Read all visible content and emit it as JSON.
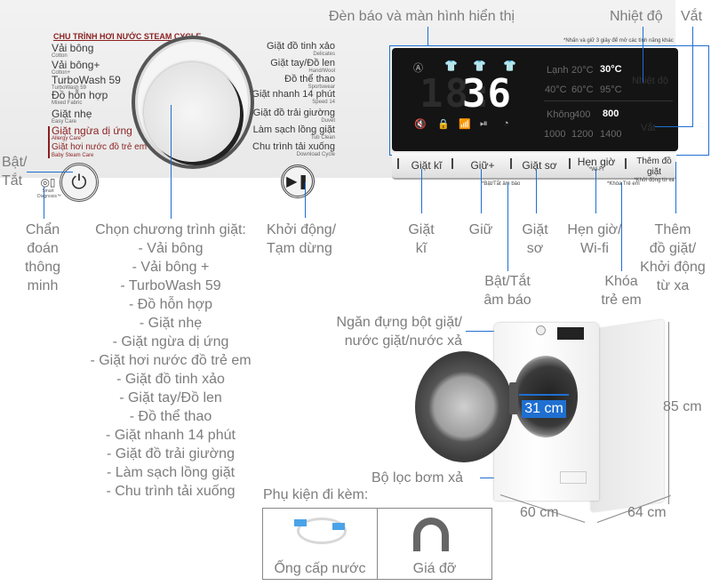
{
  "callouts": {
    "display": "Đèn báo và màn hình hiển thị",
    "temperature": "Nhiệt độ",
    "spin": "Vắt",
    "power_line1": "Bật/",
    "power_line2": "Tắt",
    "smart_diag": [
      "Chẩn",
      "đoán",
      "thông",
      "minh"
    ],
    "program_title": "Chọn chương trình giặt:",
    "program_list": [
      "- Vải bông",
      "- Vải bông +",
      "- TurboWash 59",
      "- Đồ hỗn hợp",
      "- Giặt nhẹ",
      "- Giặt ngừa dị ứng",
      "- Giặt hơi nước đồ trẻ em",
      "- Giặt đồ tinh xảo",
      "- Giặt tay/Đồ len",
      "- Đồ thể thao",
      "- Giặt nhanh 14 phút",
      "- Giặt đồ trải giường",
      "- Làm sạch lồng giặt",
      "- Chu trình tải xuống"
    ],
    "start_pause": [
      "Khởi động/",
      "Tạm dừng"
    ],
    "rinse": [
      "Giặt",
      "kĩ"
    ],
    "hold": "Giữ",
    "prewash": [
      "Giặt",
      "sơ"
    ],
    "timer_wifi": [
      "Hẹn giờ/",
      "Wi-fi"
    ],
    "add_item": [
      "Thêm",
      "đồ giặt/",
      "Khởi động",
      "từ xa"
    ],
    "sound": [
      "Bật/Tắt",
      "âm báo"
    ],
    "child_lock": [
      "Khóa",
      "trẻ em"
    ],
    "detergent": [
      "Ngăn đựng bột giặt/",
      "nước giặt/nước xả"
    ],
    "filter": "Bộ lọc bơm xả"
  },
  "panel": {
    "steam_title": "CHU TRÌNH HƠI NƯỚC STEAM CYCLE",
    "programs_left": [
      {
        "vi": "Vải bông",
        "en": "Cotton",
        "red": false
      },
      {
        "vi": "Vải bông+",
        "en": "Cotton+",
        "red": false
      },
      {
        "vi": "TurboWash 59",
        "en": "TurboWash 59",
        "red": false
      },
      {
        "vi": "Đồ hỗn hợp",
        "en": "Mixed Fabric",
        "red": false
      },
      {
        "vi": "Giặt nhẹ",
        "en": "Easy Care",
        "red": false
      },
      {
        "vi": "Giặt ngừa dị ứng",
        "en": "Allergy Care",
        "red": true
      },
      {
        "vi": "Giặt hơi nước đồ trẻ em",
        "en": "Baby Steam Care",
        "red": true
      }
    ],
    "programs_right": [
      {
        "vi": "Giặt đồ tinh xảo",
        "en": "Delicates"
      },
      {
        "vi": "Giặt tay/Đồ len",
        "en": "Hand/Wool"
      },
      {
        "vi": "Đồ thể thao",
        "en": "Sportswear"
      },
      {
        "vi": "Giặt nhanh 14 phút",
        "en": "Speed 14"
      },
      {
        "vi": "Giặt đồ trải giường",
        "en": "Duvet"
      },
      {
        "vi": "Làm sạch lồng giặt",
        "en": "Tub Clean"
      },
      {
        "vi": "Chu trình tải xuống",
        "en": "Download Cycle"
      }
    ],
    "smart_diag_label": "Smart Diagnosis™",
    "press_note": "*Nhấn và giữ 3 giây để mở các tính năng khác",
    "display_digits": "36",
    "display_dim_digits": "18:",
    "temp_options": [
      [
        "Lạnh",
        "20°C",
        "30°C"
      ],
      [
        "40°C",
        "60°C",
        "95°C"
      ]
    ],
    "temp_selected": "30°C",
    "spin_options": [
      [
        "Không",
        "400",
        "800"
      ],
      [
        "1000",
        "1200",
        "1400"
      ]
    ],
    "spin_selected": "800",
    "temp_label": "Nhiệt độ",
    "spin_label": "Vắt",
    "buttons": [
      {
        "label": "Giặt kĩ",
        "sub": ""
      },
      {
        "label": "Giữ+",
        "sub": ""
      },
      {
        "label": "Giặt sơ",
        "sub": ""
      },
      {
        "label": "Hẹn giờ",
        "sub": "*Wi-Fi"
      },
      {
        "label": "Thêm đồ giặt",
        "sub": "*Khởi động từ xa"
      }
    ],
    "sound_note": "*Bật/Tắt âm báo",
    "lock_note": "*Khóa Trẻ em"
  },
  "dimensions": {
    "drum": "31 cm",
    "height": "85 cm",
    "width": "60 cm",
    "depth": "64 cm"
  },
  "accessories": {
    "title": "Phụ kiện đi kèm:",
    "items": [
      "Ống cấp nước",
      "Giá đỡ"
    ]
  }
}
